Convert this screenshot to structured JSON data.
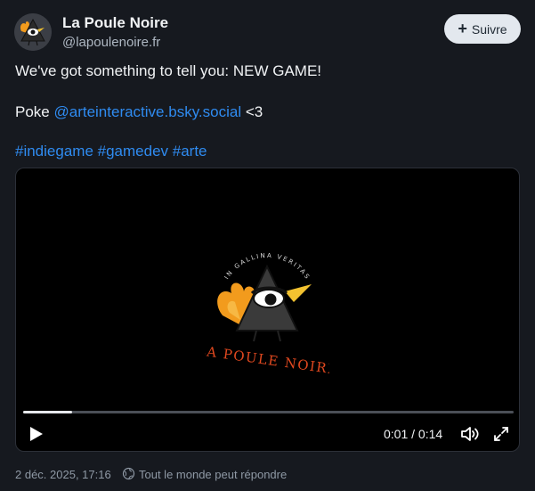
{
  "author": {
    "display_name": "La Poule Noire",
    "handle": "@lapoulenoire.fr",
    "avatar_icon": "black-hen-triangle-logo"
  },
  "follow_button": {
    "label": "Suivre",
    "icon": "plus-icon"
  },
  "post": {
    "headline": "We've got something to tell you: NEW GAME!",
    "poke_prefix": "Poke ",
    "mention": "@arteinteractive.bsky.social",
    "poke_suffix": " <3",
    "hashtags": [
      "#indiegame",
      "#gamedev",
      "#arte"
    ]
  },
  "video": {
    "logo_arc_text": "IN GALLINA VERITAS",
    "logo_wordmark": "LA POULE NOIRE",
    "current_time": "0:01",
    "duration": "0:14",
    "time_display": "0:01 / 0:14",
    "progress_fraction": 0.1,
    "controls": [
      "play-icon",
      "volume-icon",
      "fullscreen-icon"
    ]
  },
  "footer": {
    "timestamp": "2 déc. 2025, 17:16",
    "reply_setting": "Tout le monde peut répondre",
    "reply_icon": "globe-icon"
  },
  "colors": {
    "background": "#16191f",
    "link": "#2f8bf0",
    "accent_orange": "#f29b1d",
    "wordmark_red": "#e0481f"
  }
}
